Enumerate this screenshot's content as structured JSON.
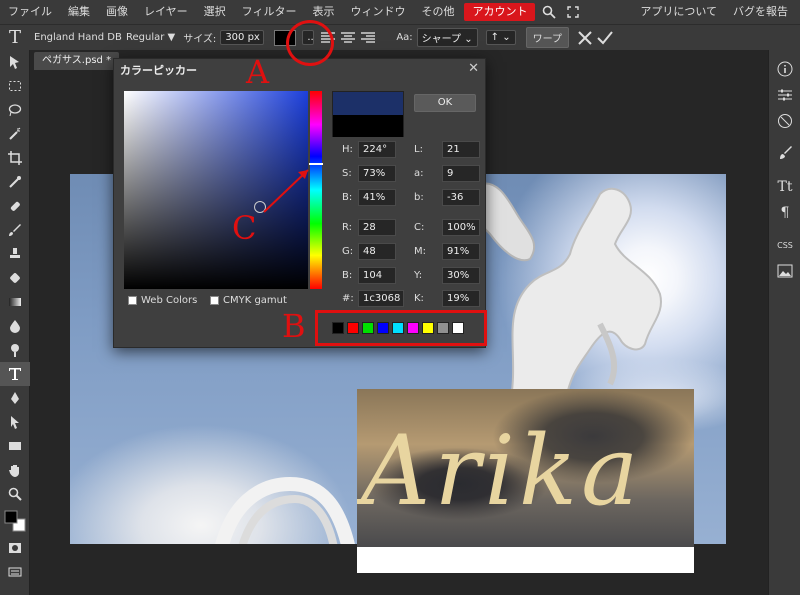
{
  "menubar": {
    "items": [
      "ファイル",
      "編集",
      "画像",
      "レイヤー",
      "選択",
      "フィルター",
      "表示",
      "ウィンドウ",
      "その他",
      "アカウント"
    ],
    "right": [
      "アプリについて",
      "バグを報告"
    ]
  },
  "options": {
    "font": "England Hand DB",
    "style": "Regular",
    "size_label": "サイズ:",
    "size_value": "300 px",
    "aa_label": "Aa:",
    "aa_value": "シャープ",
    "leading": "↑",
    "warp": "ワープ"
  },
  "doc_tab": "ペガサス.psd *",
  "canvas_text": "Arika",
  "picker": {
    "title": "カラーピッカー",
    "ok": "OK",
    "new_color": "#1c3068",
    "old_color": "#000000",
    "fields": {
      "H": "224°",
      "S": "73%",
      "Bv": "41%",
      "R": "28",
      "G": "48",
      "Bc": "104",
      "hex": "1c3068",
      "L": "21",
      "a": "9",
      "b": "-36",
      "C": "100%",
      "M": "91%",
      "Y": "30%",
      "K": "19%"
    },
    "web_colors": "Web Colors",
    "cmyk_gamut": "CMYK gamut",
    "swatches": [
      "#000000",
      "#ff0000",
      "#00e000",
      "#0000ff",
      "#00e0ff",
      "#ff00ff",
      "#ffff00",
      "#909090",
      "#ffffff"
    ]
  },
  "annotations": {
    "a": "A",
    "b": "B",
    "c": "C"
  },
  "accent": "#d9161c"
}
